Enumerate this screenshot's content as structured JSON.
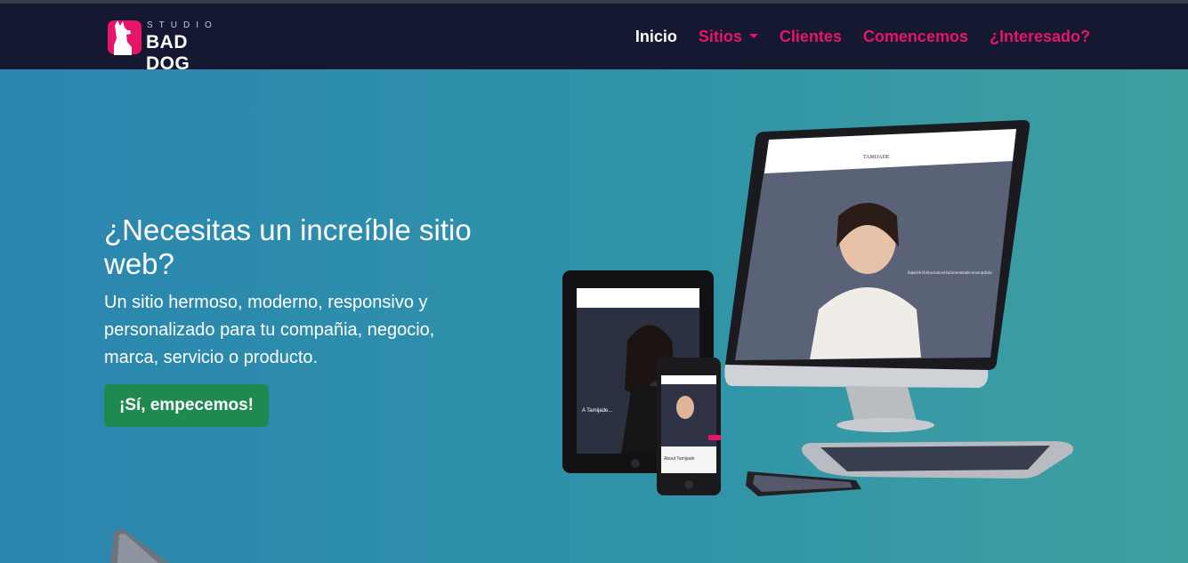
{
  "brand": {
    "studio": "STUDIO",
    "name": "BAD DOG",
    "badge_color": "#e8146a"
  },
  "nav": {
    "items": [
      {
        "label": "Inicio",
        "active": true
      },
      {
        "label": "Sitios",
        "dropdown": true
      },
      {
        "label": "Clientes"
      },
      {
        "label": "Comencemos"
      },
      {
        "label": "¿Interesado?"
      }
    ],
    "active_color": "#ffffff",
    "link_color": "#e8146a"
  },
  "hero": {
    "title": "¿Necesitas un increíble sitio web?",
    "subtitle": "Un sitio hermoso, moderno, responsivo y personalizado para tu compañia, negocio, marca, servicio o producto.",
    "cta_label": "¡Sí, empecemos!",
    "cta_color": "#1e8a4f"
  },
  "mockup": {
    "site_name": "TAMIJADE",
    "monitor_caption": "Designed in the UK with you in mind, each brush has been hand made to our exact specification.",
    "tablet_caption": "A Tamijade...",
    "phone_caption": "About Tamijade"
  }
}
